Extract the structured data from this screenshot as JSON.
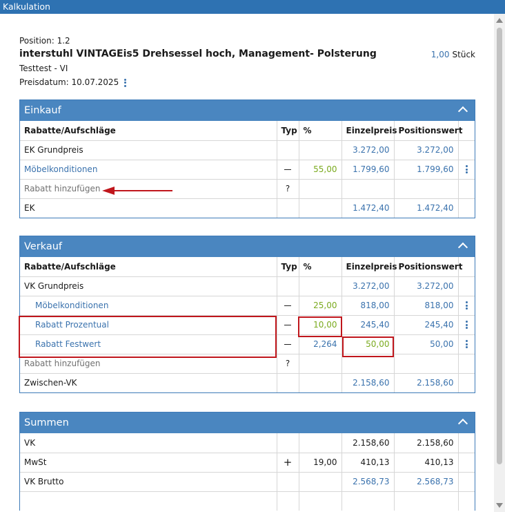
{
  "window": {
    "title": "Kalkulation"
  },
  "header": {
    "position": "Position: 1.2",
    "title": "interstuhl VINTAGEis5 Drehsessel hoch, Management- Polsterung",
    "subtitle": "Testtest - VI",
    "preisdatum": "Preisdatum: 10.07.2025",
    "qty_value": "1,00",
    "qty_unit": "Stück"
  },
  "columns": [
    "Rabatte/Aufschläge",
    "Typ",
    "%",
    "Einzelpreis",
    "Positionswert"
  ],
  "einkauf": {
    "title": "Einkauf",
    "rows": [
      {
        "name": "EK Grundpreis",
        "typ": "",
        "pct": "",
        "ez": "3.272,00",
        "pw": "3.272,00"
      },
      {
        "name": "Möbelkonditionen",
        "typ": "—",
        "pct": "55,00",
        "ez": "1.799,60",
        "pw": "1.799,60"
      },
      {
        "name": "Rabatt hinzufügen",
        "typ": "?",
        "pct": "",
        "ez": "",
        "pw": ""
      },
      {
        "name": "EK",
        "typ": "",
        "pct": "",
        "ez": "1.472,40",
        "pw": "1.472,40"
      }
    ]
  },
  "verkauf": {
    "title": "Verkauf",
    "rows": [
      {
        "name": "VK Grundpreis",
        "typ": "",
        "pct": "",
        "ez": "3.272,00",
        "pw": "3.272,00"
      },
      {
        "name": "Möbelkonditionen",
        "typ": "—",
        "pct": "25,00",
        "ez": "818,00",
        "pw": "818,00"
      },
      {
        "name": "Rabatt Prozentual",
        "typ": "—",
        "pct": "10,00",
        "ez": "245,40",
        "pw": "245,40"
      },
      {
        "name": "Rabatt Festwert",
        "typ": "—",
        "pct": "2,264",
        "ez": "50,00",
        "pw": "50,00"
      },
      {
        "name": "Rabatt hinzufügen",
        "typ": "?",
        "pct": "",
        "ez": "",
        "pw": ""
      },
      {
        "name": "Zwischen-VK",
        "typ": "",
        "pct": "",
        "ez": "2.158,60",
        "pw": "2.158,60"
      }
    ]
  },
  "summen": {
    "title": "Summen",
    "rows": [
      {
        "name": "VK",
        "typ": "",
        "pct": "",
        "ez": "2.158,60",
        "pw": "2.158,60"
      },
      {
        "name": "MwSt",
        "typ": "+",
        "pct": "19,00",
        "ez": "410,13",
        "pw": "410,13"
      },
      {
        "name": "VK Brutto",
        "typ": "",
        "pct": "",
        "ez": "2.568,73",
        "pw": "2.568,73"
      },
      {
        "name": "",
        "typ": "",
        "pct": "",
        "ez": "",
        "pw": ""
      }
    ]
  },
  "colors": {
    "accent": "#4a86c0",
    "link": "#3a72ad",
    "green": "#7aaa1e",
    "highlight": "#c0161c"
  }
}
